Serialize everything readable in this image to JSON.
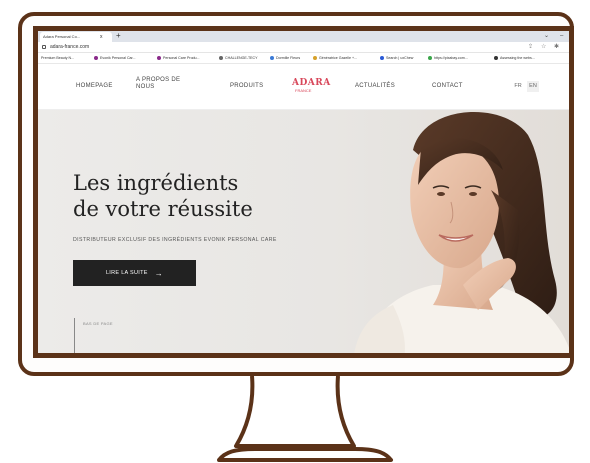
{
  "browser": {
    "tab_title": "Adara Personal Co...",
    "tab_close": "x",
    "new_tab": "+",
    "url": "adara-france.com",
    "window_min": "⌄",
    "window_max": "–",
    "bookmarks": [
      {
        "label": "Premium Beauty N...",
        "color": "#7a5cd6"
      },
      {
        "label": "Evonik Personal Car...",
        "color": "#8a2a8a"
      },
      {
        "label": "Personal Care Produ...",
        "color": "#8a2a8a"
      },
      {
        "label": "CHALLENGE-TECY",
        "color": "#666666"
      },
      {
        "label": "Dormille Fleurs",
        "color": "#3a7ad6"
      },
      {
        "label": "Génératrice Gazelle +...",
        "color": "#d6a12a"
      },
      {
        "label": "Search | uxChew",
        "color": "#2a5ad6"
      },
      {
        "label": "https://pixabay.com...",
        "color": "#3aa64a"
      },
      {
        "label": "Assessing the webs...",
        "color": "#333333"
      }
    ]
  },
  "nav": {
    "homepage": "HOMEPAGE",
    "apropos_line1": "A PROPOS DE",
    "apropos_line2": "NOUS",
    "produits": "PRODUITS",
    "logo": "ADARA",
    "logo_sub": "FRANCE",
    "actualites": "ACTUALITÉS",
    "contact": "CONTACT",
    "lang_fr": "FR",
    "lang_en": "EN"
  },
  "hero": {
    "title_line1": "Les ingrédients",
    "title_line2": "de votre réussite",
    "subtitle": "DISTRIBUTEUR EXCLUSIF DES INGRÉDIENTS EVONIK PERSONAL CARE",
    "cta_label": "LIRE LA SUITE",
    "cta_arrow": "→",
    "scroll_label": "BAS DE PAGE"
  },
  "colors": {
    "frame": "#5b3218",
    "brand": "#d8475a",
    "cta_bg": "#222222"
  }
}
